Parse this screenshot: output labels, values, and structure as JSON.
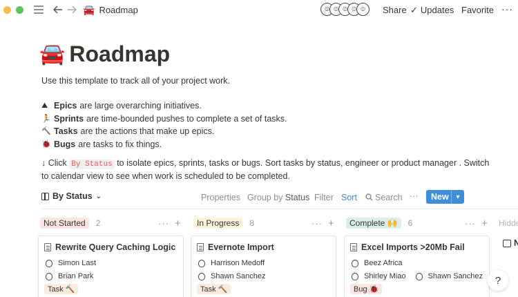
{
  "topbar": {
    "crumb_emoji": "🚘",
    "crumb_title": "Roadmap",
    "avatars": [
      "☺",
      "☺",
      "☺",
      "☺",
      "☺"
    ],
    "share": "Share",
    "updates": "Updates",
    "favorite": "Favorite",
    "more": "···"
  },
  "header": {
    "emoji": "🚘",
    "title": "Roadmap",
    "description": "Use this template to track all of your project work.",
    "bullets": [
      {
        "emoji": "⛰",
        "term": "Epics",
        "text": "are large overarching initiatives."
      },
      {
        "emoji": "🏃",
        "term": "Sprints",
        "text": "are time-bounded pushes to complete a set of tasks."
      },
      {
        "emoji": "🔨",
        "term": "Tasks",
        "text": "are the actions that make up epics."
      },
      {
        "emoji": "🐞",
        "term": "Bugs",
        "text": "are tasks to fix things."
      }
    ],
    "info_prefix": "↓ Click",
    "info_code": "By Status",
    "info_rest": "to isolate epics, sprints, tasks or bugs. Sort tasks by status, engineer or product manager . Switch",
    "info_line2": "to calendar view to see when work is scheduled to be completed."
  },
  "viewbar": {
    "view_label": "By Status",
    "properties": "Properties",
    "group_by": "Group by",
    "group_value": "Status",
    "filter": "Filter",
    "sort": "Sort",
    "search": "Search",
    "more": "···",
    "new": "New",
    "new_caret": "▾"
  },
  "columns": [
    {
      "label": "Not Started",
      "count": "2",
      "color": "#fbe4e4"
    },
    {
      "label": "In Progress",
      "count": "8",
      "color": "#fbf3db"
    },
    {
      "label": "Complete 🙌",
      "count": "6",
      "color": "#ddedea"
    }
  ],
  "hidden_label": "Hidde",
  "cards": [
    {
      "title": "Rewrite Query Caching Logic",
      "person1": "Simon Last",
      "person2": "Brian Park",
      "person2b": "",
      "tag": "Task 🔨"
    },
    {
      "title": "Evernote Import",
      "person1": "Harrison Medoff",
      "person2": "Shawn Sanchez",
      "person2b": "",
      "tag": "Task 🔨"
    },
    {
      "title": "Excel Imports >20Mb Fail",
      "person1": "Beez Africa",
      "person2": "Shirley Miao",
      "person2b": "Shawn Sanchez",
      "tag": "Bug 🐞"
    }
  ],
  "card_ext_letter": "N",
  "help": "?"
}
